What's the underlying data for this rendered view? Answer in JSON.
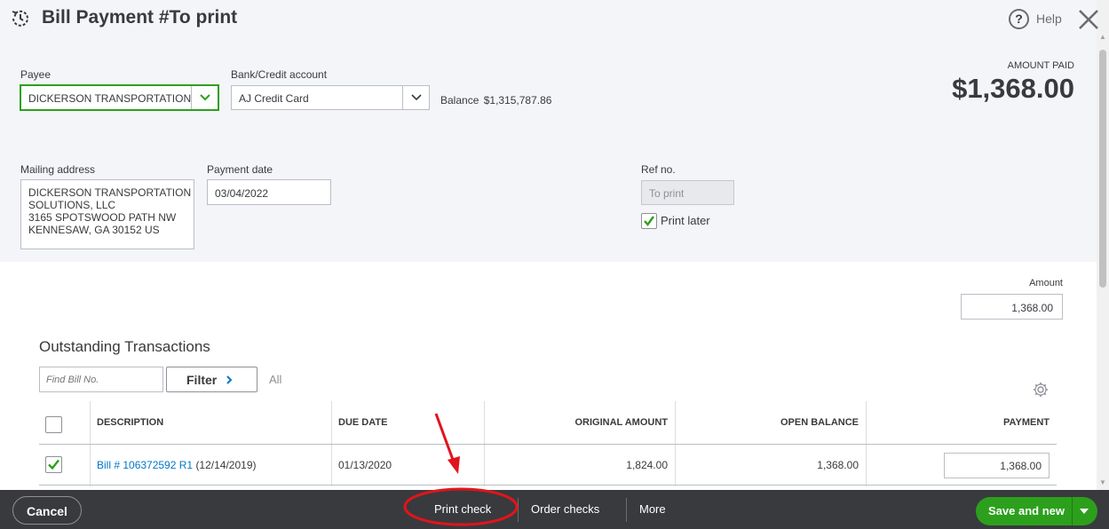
{
  "header": {
    "title": "Bill Payment #To print",
    "help_label": "Help"
  },
  "form": {
    "payee_label": "Payee",
    "payee_value": "DICKERSON TRANSPORTATION S",
    "bank_label": "Bank/Credit account",
    "bank_value": "AJ Credit Card",
    "balance_label": "Balance",
    "balance_value": "$1,315,787.86",
    "amount_paid_label": "AMOUNT PAID",
    "amount_paid_value": "$1,368.00",
    "mailing_label": "Mailing address",
    "mailing_lines": [
      "DICKERSON TRANSPORTATION",
      "SOLUTIONS, LLC",
      "3165 SPOTSWOOD PATH NW",
      "KENNESAW, GA  30152 US"
    ],
    "payment_date_label": "Payment date",
    "payment_date_value": "03/04/2022",
    "ref_label": "Ref no.",
    "ref_placeholder": "To print",
    "print_later_label": "Print later",
    "print_later_checked": true,
    "amount_label": "Amount",
    "amount_value": "1,368.00"
  },
  "transactions": {
    "title": "Outstanding Transactions",
    "find_placeholder": "Find Bill No.",
    "filter_label": "Filter",
    "filter_state": "All",
    "columns": [
      "DESCRIPTION",
      "DUE DATE",
      "ORIGINAL AMOUNT",
      "OPEN BALANCE",
      "PAYMENT"
    ],
    "rows": [
      {
        "checked": true,
        "link_text": "Bill # 106372592 R1",
        "date_text": "(12/14/2019)",
        "due_date": "01/13/2020",
        "original_amount": "1,824.00",
        "open_balance": "1,368.00",
        "payment": "1,368.00"
      }
    ]
  },
  "footer": {
    "cancel_label": "Cancel",
    "print_check_label": "Print check",
    "order_checks_label": "Order checks",
    "more_label": "More",
    "save_new_label": "Save and new"
  },
  "colors": {
    "accent_green": "#2ca01c",
    "link_blue": "#0077c5",
    "annotation_red": "#e2141b",
    "footer_bg": "#393a3d"
  }
}
